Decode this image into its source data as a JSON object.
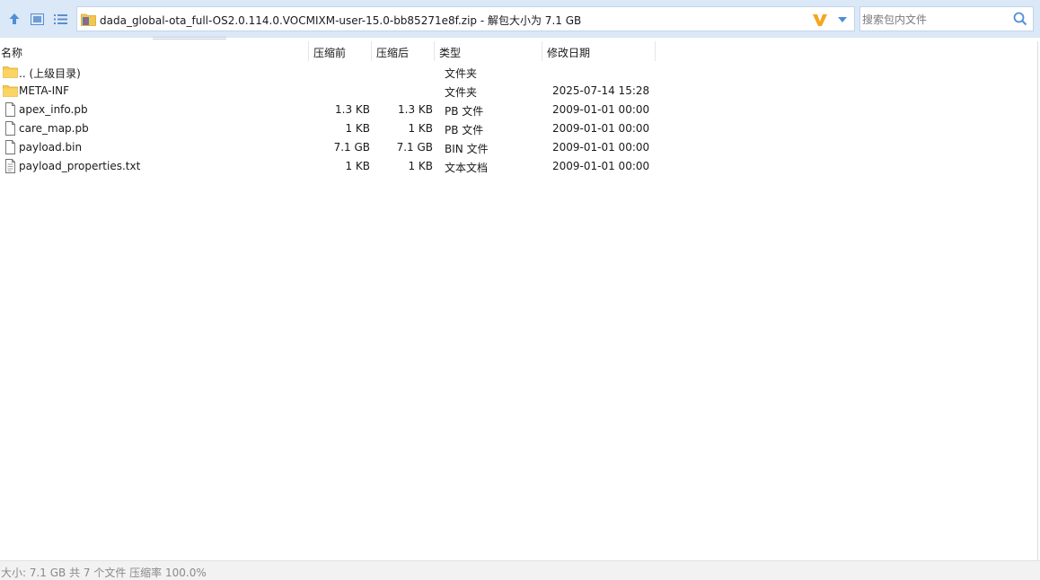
{
  "toolbar": {
    "path_text": "dada_global-ota_full-OS2.0.114.0.VOCMIXM-user-15.0-bb85271e8f.zip - 解包大小为 7.1 GB",
    "search_placeholder": "搜索包内文件",
    "accent": "#3a86d6"
  },
  "columns": {
    "name": "名称",
    "size": "压缩前",
    "packed": "压缩后",
    "type": "类型",
    "modified": "修改日期"
  },
  "files": [
    {
      "name": ".. (上级目录)",
      "size": "",
      "packed": "",
      "type": "文件夹",
      "modified": "",
      "icon": "folder-up-icon"
    },
    {
      "name": "META-INF",
      "size": "",
      "packed": "",
      "type": "文件夹",
      "modified": "2025-07-14 15:28",
      "icon": "folder-icon"
    },
    {
      "name": "apex_info.pb",
      "size": "1.3 KB",
      "packed": "1.3 KB",
      "type": "PB 文件",
      "modified": "2009-01-01 00:00",
      "icon": "file-icon"
    },
    {
      "name": "care_map.pb",
      "size": "1 KB",
      "packed": "1 KB",
      "type": "PB 文件",
      "modified": "2009-01-01 00:00",
      "icon": "file-icon"
    },
    {
      "name": "payload.bin",
      "size": "7.1 GB",
      "packed": "7.1 GB",
      "type": "BIN 文件",
      "modified": "2009-01-01 00:00",
      "icon": "file-icon"
    },
    {
      "name": "payload_properties.txt",
      "size": "1 KB",
      "packed": "1 KB",
      "type": "文本文档",
      "modified": "2009-01-01 00:00",
      "icon": "text-file-icon"
    }
  ],
  "status": {
    "text": "大小: 7.1 GB 共 7 个文件 压缩率 100.0%"
  }
}
